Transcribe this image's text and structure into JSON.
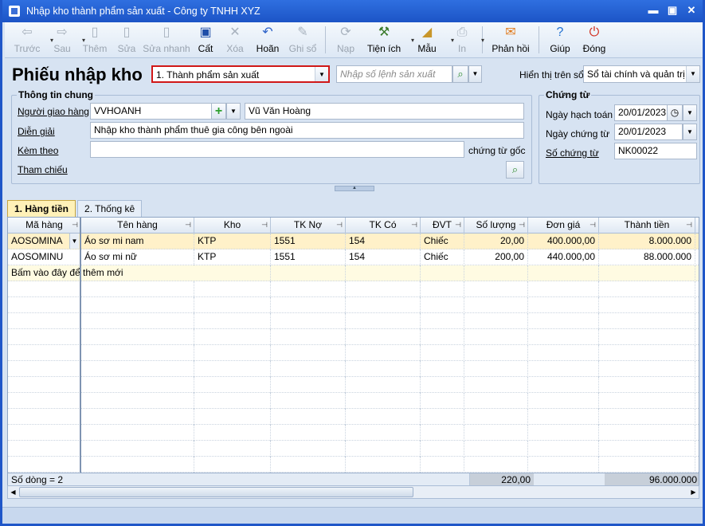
{
  "window": {
    "title": "Nhập kho thành phẩm sản xuất - Công ty TNHH XYZ",
    "controls": [
      "minimize",
      "maximize",
      "close"
    ]
  },
  "toolbar": [
    {
      "key": "back",
      "label": "Trước",
      "icon": "back-arrow-icon",
      "glyph": "⇦",
      "enabled": false,
      "dropdown": true
    },
    {
      "key": "next",
      "label": "Sau",
      "icon": "forward-arrow-icon",
      "glyph": "⇨",
      "enabled": false,
      "dropdown": true
    },
    {
      "key": "add",
      "label": "Thêm",
      "icon": "add-document-icon",
      "glyph": "▯",
      "enabled": false
    },
    {
      "key": "edit",
      "label": "Sửa",
      "icon": "edit-document-icon",
      "glyph": "▯",
      "enabled": false
    },
    {
      "key": "quickedit",
      "label": "Sửa nhanh",
      "icon": "quick-edit-icon",
      "glyph": "▯",
      "enabled": false
    },
    {
      "key": "save",
      "label": "Cất",
      "icon": "save-icon",
      "glyph": "▣",
      "enabled": true,
      "color": "#1f4ea8"
    },
    {
      "key": "delete",
      "label": "Xóa",
      "icon": "delete-icon",
      "glyph": "✕",
      "enabled": false
    },
    {
      "key": "undo",
      "label": "Hoãn",
      "icon": "undo-icon",
      "glyph": "↶",
      "enabled": true,
      "color": "#2a60c8"
    },
    {
      "key": "post",
      "label": "Ghi sổ",
      "icon": "pencil-icon",
      "glyph": "✎",
      "enabled": false
    },
    {
      "key": "reload",
      "label": "Nạp",
      "icon": "reload-icon",
      "glyph": "⟳",
      "enabled": false,
      "sepBefore": true
    },
    {
      "key": "utils",
      "label": "Tiện ích",
      "icon": "tools-icon",
      "glyph": "⚒",
      "enabled": true,
      "dropdown": true,
      "color": "#3a7a2a"
    },
    {
      "key": "template",
      "label": "Mẫu",
      "icon": "template-icon",
      "glyph": "◢",
      "enabled": true,
      "dropdown": true,
      "color": "#c8962a"
    },
    {
      "key": "print",
      "label": "In",
      "icon": "printer-icon",
      "glyph": "⎙",
      "enabled": false,
      "dropdown": true
    },
    {
      "key": "feedback",
      "label": "Phản hồi",
      "icon": "envelope-icon",
      "glyph": "✉",
      "enabled": true,
      "sepBefore": true,
      "color": "#e07a1c"
    },
    {
      "key": "help",
      "label": "Giúp",
      "icon": "help-icon",
      "glyph": "?",
      "enabled": true,
      "sepBefore": true,
      "color": "#1f6fd0"
    },
    {
      "key": "close",
      "label": "Đóng",
      "icon": "power-icon",
      "glyph": "⏻",
      "enabled": true,
      "color": "#d02a1a"
    }
  ],
  "header": {
    "title": "Phiếu nhập kho",
    "type_value": "1. Thành phẩm sản xuất",
    "order_placeholder": "Nhập số lệnh sản xuất",
    "display_label": "Hiển thị trên sổ",
    "display_value": "Sổ tài chính và quản trị"
  },
  "general": {
    "legend": "Thông tin chung",
    "deliverer_label": "Người giao hàng",
    "deliverer_code": "VVHOANH",
    "deliverer_name": "Vũ Văn Hoàng",
    "desc_label": "Diễn giải",
    "desc_value": "Nhập kho thành phẩm thuê gia công bên ngoài",
    "attach_label": "Kèm theo",
    "attach_value": "",
    "attach_suffix": "chứng từ gốc",
    "ref_label": "Tham chiếu"
  },
  "voucher": {
    "legend": "Chứng từ",
    "posting_date_label": "Ngày hạch toán",
    "posting_date": "20/01/2023",
    "voucher_date_label": "Ngày chứng từ",
    "voucher_date": "20/01/2023",
    "voucher_no_label": "Số chứng từ",
    "voucher_no": "NK00022"
  },
  "tabs": [
    {
      "label": "1. Hàng tiền",
      "active": true
    },
    {
      "label": "2. Thống kê",
      "active": false
    }
  ],
  "grid": {
    "columns": [
      "Mã hàng",
      "Tên hàng",
      "Kho",
      "TK Nợ",
      "TK Có",
      "ĐVT",
      "Số lượng",
      "Đơn giá",
      "Thành tiền"
    ],
    "rows": [
      [
        "AOSOMINA",
        "Áo sơ mi nam",
        "KTP",
        "1551",
        "154",
        "Chiếc",
        "20,00",
        "400.000,00",
        "8.000.000"
      ],
      [
        "AOSOMINU",
        "Áo sơ mi nữ",
        "KTP",
        "1551",
        "154",
        "Chiếc",
        "200,00",
        "440.000,00",
        "88.000.000"
      ]
    ],
    "new_row_hint": "Bấm vào đây để thêm mới",
    "footer": {
      "row_count": "Số dòng = 2",
      "qty_total": "220,00",
      "amount_total": "96.000.000"
    }
  }
}
